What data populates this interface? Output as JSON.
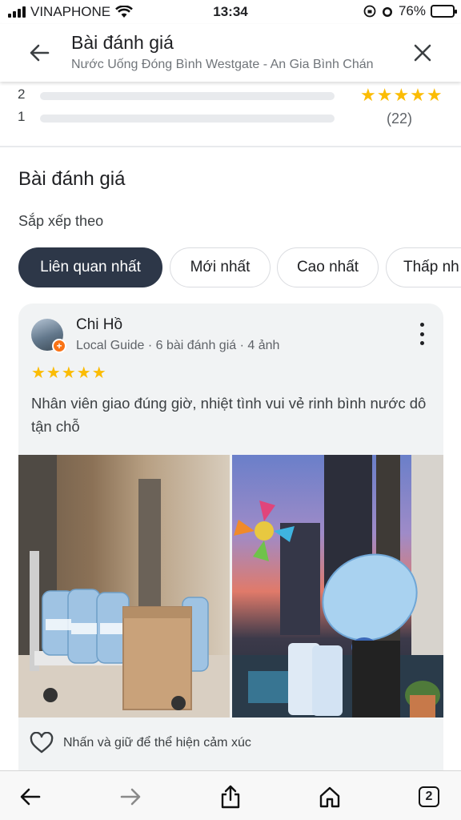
{
  "status_bar": {
    "carrier": "VINAPHONE",
    "time": "13:34",
    "battery": "76%"
  },
  "header": {
    "title": "Bài đánh giá",
    "subtitle": "Nước Uống Đóng Bình Westgate - An Gia Bình Chán"
  },
  "rating_summary": {
    "rows": [
      {
        "label": "2"
      },
      {
        "label": "1"
      }
    ],
    "stars": "★★★★★",
    "count": "(22)"
  },
  "reviews_section": {
    "title": "Bài đánh giá",
    "sort_label": "Sắp xếp theo",
    "chips": [
      {
        "label": "Liên quan nhất"
      },
      {
        "label": "Mới nhất"
      },
      {
        "label": "Cao nhất"
      },
      {
        "label": "Thấp nh"
      }
    ]
  },
  "review": {
    "author": "Chi Hồ",
    "meta": "Local Guide · 6 bài đánh giá · 4 ảnh",
    "stars": "★★★★★",
    "rating": 5,
    "text": "Nhân viên giao đúng giờ, nhiệt tình vui vẻ rinh bình nước dô tận chỗ",
    "react_hint": "Nhấn và giữ để thể hiện cảm xúc"
  },
  "bottom_bar": {
    "tab_count": "2"
  },
  "colors": {
    "active_chip": "#2d3748",
    "star": "#fbbc04",
    "card_bg": "#f1f3f4"
  },
  "icons": [
    "back-arrow-icon",
    "close-icon",
    "more-vert-icon",
    "heart-icon",
    "browser-back-icon",
    "browser-forward-icon",
    "share-icon",
    "home-icon",
    "tabs-icon"
  ]
}
